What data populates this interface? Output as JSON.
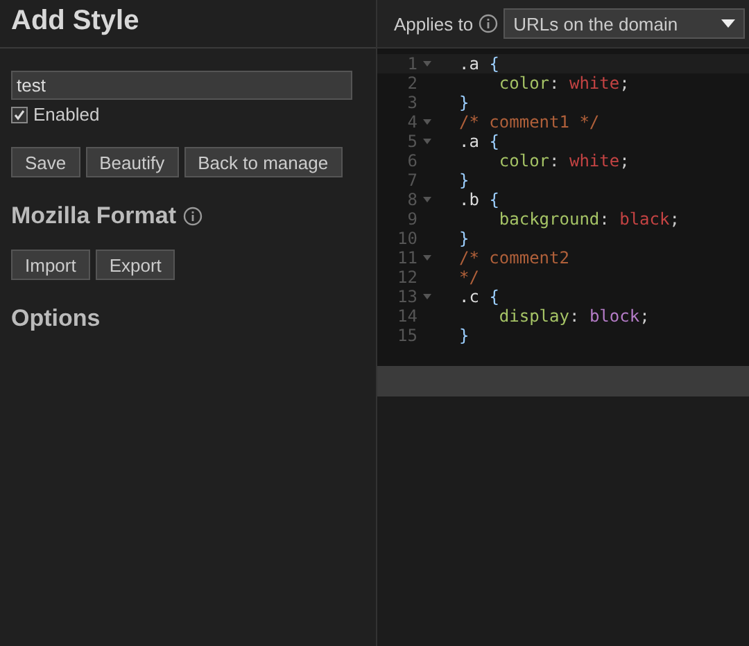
{
  "title": "Add Style",
  "name_field": {
    "value": "test"
  },
  "enabled": {
    "label": "Enabled",
    "checked": true
  },
  "actions": [
    "Save",
    "Beautify",
    "Back to manage"
  ],
  "mozilla_format": {
    "heading": "Mozilla Format",
    "buttons": [
      "Import",
      "Export"
    ]
  },
  "options_heading": "Options",
  "applies_to": {
    "label": "Applies to",
    "value": "URLs on the domain"
  },
  "code": [
    {
      "number": "1",
      "fold": true,
      "tokens": [
        {
          "kind": "selector",
          "text": ".a "
        },
        {
          "kind": "brace",
          "text": "{"
        }
      ]
    },
    {
      "number": "2",
      "fold": false,
      "tokens": [
        {
          "kind": "property",
          "text": "    color"
        },
        {
          "kind": "punct",
          "text": ": "
        },
        {
          "kind": "value",
          "text": "white"
        },
        {
          "kind": "punct",
          "text": ";"
        }
      ]
    },
    {
      "number": "3",
      "fold": false,
      "tokens": [
        {
          "kind": "brace",
          "text": "}"
        }
      ]
    },
    {
      "number": "4",
      "fold": true,
      "tokens": [
        {
          "kind": "comment",
          "text": "/* comment1 */"
        }
      ]
    },
    {
      "number": "5",
      "fold": true,
      "tokens": [
        {
          "kind": "selector",
          "text": ".a "
        },
        {
          "kind": "brace",
          "text": "{"
        }
      ]
    },
    {
      "number": "6",
      "fold": false,
      "tokens": [
        {
          "kind": "property",
          "text": "    color"
        },
        {
          "kind": "punct",
          "text": ": "
        },
        {
          "kind": "value",
          "text": "white"
        },
        {
          "kind": "punct",
          "text": ";"
        }
      ]
    },
    {
      "number": "7",
      "fold": false,
      "tokens": [
        {
          "kind": "brace",
          "text": "}"
        }
      ]
    },
    {
      "number": "8",
      "fold": true,
      "tokens": [
        {
          "kind": "selector",
          "text": ".b "
        },
        {
          "kind": "brace",
          "text": "{"
        }
      ]
    },
    {
      "number": "9",
      "fold": false,
      "tokens": [
        {
          "kind": "property",
          "text": "    background"
        },
        {
          "kind": "punct",
          "text": ": "
        },
        {
          "kind": "value",
          "text": "black"
        },
        {
          "kind": "punct",
          "text": ";"
        }
      ]
    },
    {
      "number": "10",
      "fold": false,
      "tokens": [
        {
          "kind": "brace",
          "text": "}"
        }
      ]
    },
    {
      "number": "11",
      "fold": true,
      "tokens": [
        {
          "kind": "comment",
          "text": "/* comment2"
        }
      ]
    },
    {
      "number": "12",
      "fold": false,
      "tokens": [
        {
          "kind": "comment",
          "text": "*/"
        }
      ]
    },
    {
      "number": "13",
      "fold": true,
      "tokens": [
        {
          "kind": "selector",
          "text": ".c "
        },
        {
          "kind": "brace",
          "text": "{"
        }
      ]
    },
    {
      "number": "14",
      "fold": false,
      "tokens": [
        {
          "kind": "property",
          "text": "    display"
        },
        {
          "kind": "punct",
          "text": ": "
        },
        {
          "kind": "keyword",
          "text": "block"
        },
        {
          "kind": "punct",
          "text": ";"
        }
      ]
    },
    {
      "number": "15",
      "fold": false,
      "tokens": [
        {
          "kind": "brace",
          "text": "}"
        }
      ]
    }
  ]
}
